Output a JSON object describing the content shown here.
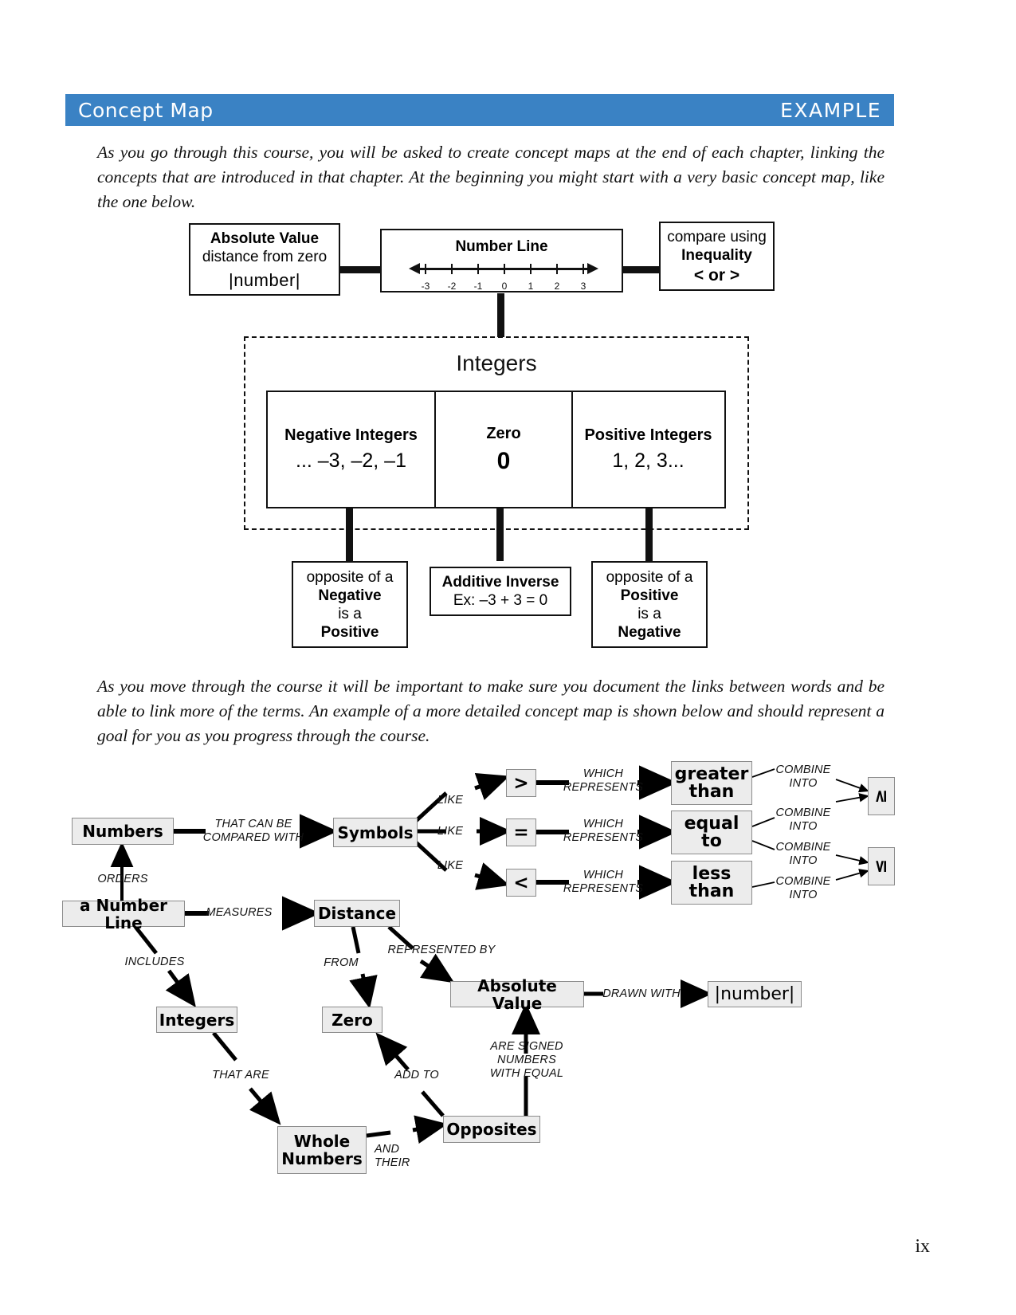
{
  "banner": {
    "title": "Concept Map",
    "tag": "EXAMPLE",
    "color": "#3a82c4"
  },
  "paragraphs": {
    "intro": "As you go through this course, you will be asked to create concept maps at the end of each chapter, linking the concepts that are introduced in that chapter. At the beginning you might start with a very basic concept map, like the one below.",
    "second": "As you move through the course it will be important to make sure you document the links between words and be able to link more of the terms. An example of a more detailed concept map is shown below and should represent a goal for you as you progress through the course."
  },
  "basic_map": {
    "absolute_value": {
      "line1": "Absolute Value",
      "line2": "distance from zero",
      "line3": "|number|"
    },
    "number_line": {
      "title": "Number Line",
      "ticks": [
        "-3",
        "-2",
        "-1",
        "0",
        "1",
        "2",
        "3"
      ]
    },
    "inequality": {
      "line1": "compare using",
      "line2": "Inequality",
      "line3": "< or >"
    },
    "integers_label": "Integers",
    "columns": [
      {
        "heading": "Negative Integers",
        "value": "... –3, –2, –1",
        "bold_value": false
      },
      {
        "heading": "Zero",
        "value": "0",
        "bold_value": true
      },
      {
        "heading": "Positive Integers",
        "value": "1, 2, 3...",
        "bold_value": false
      }
    ],
    "bottom": [
      {
        "l1": "opposite of a",
        "l2": "Negative",
        "l3": "is a",
        "l4": "Positive"
      },
      {
        "l1": "Additive Inverse",
        "l2": "Ex: –3 + 3 = 0"
      },
      {
        "l1": "opposite of a",
        "l2": "Positive",
        "l3": "is a",
        "l4": "Negative"
      }
    ]
  },
  "detailed_map": {
    "nodes": {
      "numbers": "Numbers",
      "symbols": "Symbols",
      "sym_gt": ">",
      "sym_eq": "=",
      "sym_lt": "<",
      "greater_than": "greater\nthan",
      "greater_than_l1": "greater",
      "greater_than_l2": "than",
      "equal_to_l1": "equal",
      "equal_to_l2": "to",
      "less_than_l1": "less",
      "less_than_l2": "than",
      "geq": "≥",
      "leq": "≤",
      "a_number_line": "a Number Line",
      "distance": "Distance",
      "integers": "Integers",
      "zero": "Zero",
      "absolute_value": "Absolute Value",
      "number_bars": "|number|",
      "whole_numbers_l1": "Whole",
      "whole_numbers_l2": "Numbers",
      "opposites": "Opposites"
    },
    "links": {
      "that_can_be_compared_with_l1": "THAT CAN BE",
      "that_can_be_compared_with_l2": "COMPARED WITH",
      "like1": "LIKE",
      "like2": "LIKE",
      "like3": "LIKE",
      "which_represents_1_l1": "WHICH",
      "which_represents_1_l2": "REPRESENTS",
      "which_represents_2_l1": "WHICH",
      "which_represents_2_l2": "REPRESENTS",
      "which_represents_3_l1": "WHICH",
      "which_represents_3_l2": "REPRESENTS",
      "combine_into_1_l1": "COMBINE",
      "combine_into_1_l2": "INTO",
      "combine_into_2_l1": "COMBINE",
      "combine_into_2_l2": "INTO",
      "combine_into_3_l1": "COMBINE",
      "combine_into_3_l2": "INTO",
      "combine_into_4_l1": "COMBINE",
      "combine_into_4_l2": "INTO",
      "orders": "ORDERS",
      "measures": "MEASURES",
      "includes": "INCLUDES",
      "from": "FROM",
      "represented_by": "REPRESENTED BY",
      "drawn_with": "DRAWN WITH",
      "that_are": "THAT ARE",
      "add_to": "ADD TO",
      "are_signed_numbers_l1": "ARE SIGNED NUMBERS",
      "are_signed_numbers_l2": "WITH EQUAL",
      "and_l1": "AND",
      "and_l2": "THEIR"
    }
  },
  "folio": "ix"
}
